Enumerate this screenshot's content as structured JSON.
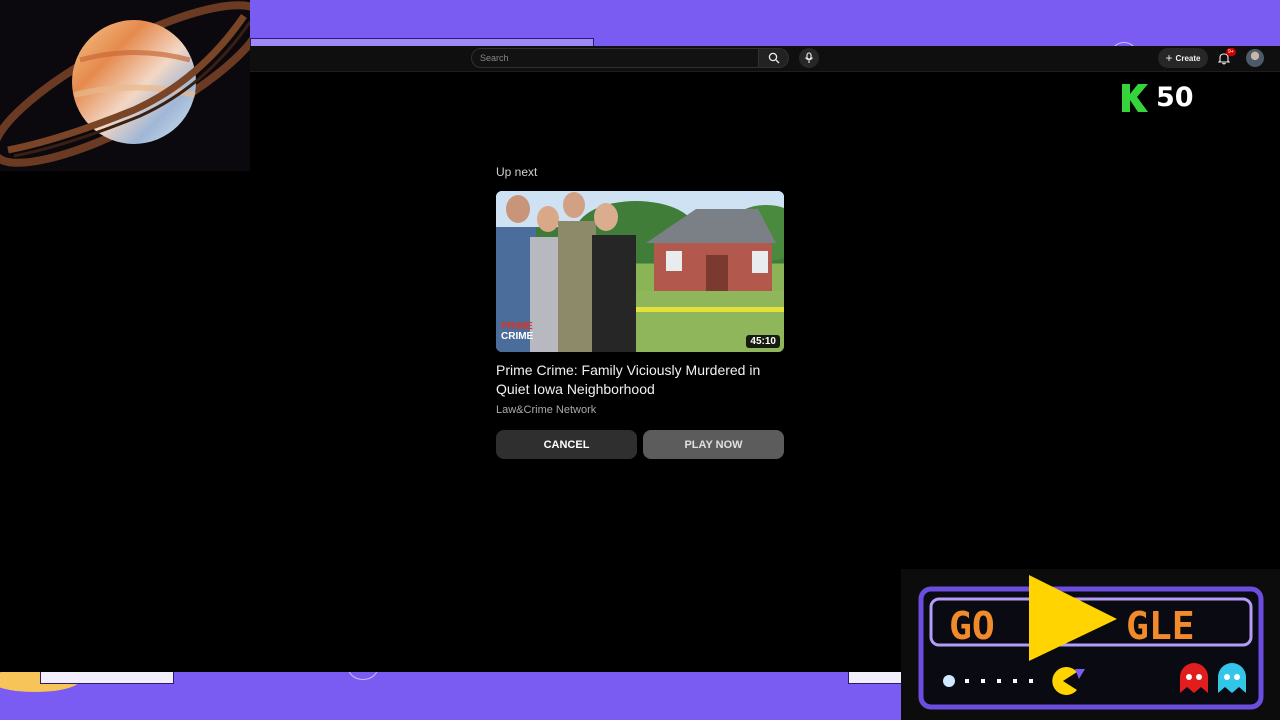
{
  "search": {
    "placeholder": "Search"
  },
  "header": {
    "create_label": "Create",
    "notification_badge": "9+"
  },
  "score": {
    "value": "50",
    "color": "#35d43a"
  },
  "up_next": {
    "label": "Up next",
    "duration": "45:10",
    "brand_top": "PRIME",
    "brand_bottom": "CRIME",
    "title": "Prime Crime: Family Viciously Murdered in Quiet Iowa Neighborhood",
    "channel": "Law&Crime Network",
    "cancel_label": "CANCEL",
    "play_label": "PLAY NOW"
  },
  "doodle": {
    "left_text": "GO",
    "right_text": "GLE",
    "text_color": "#f08a2a",
    "border_color": "#6b4de0"
  },
  "colors": {
    "background": "#7b5cf2",
    "player_bg": "#000000"
  }
}
